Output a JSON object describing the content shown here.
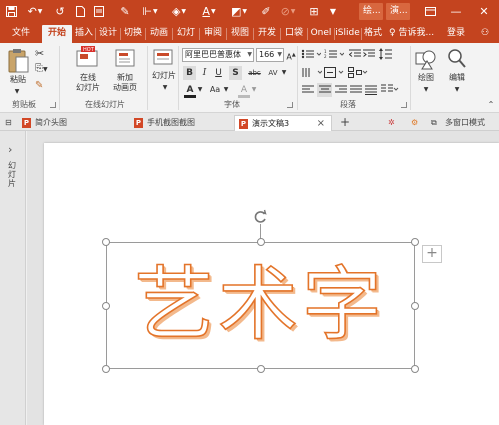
{
  "titlebar": {
    "window_tabs": [
      "绘...",
      "演..."
    ],
    "bg_color": "#c4441f"
  },
  "tabs": {
    "file": "文件",
    "home": "开始",
    "insert": "插入",
    "design": "设计",
    "transitions": "切换",
    "animations": "动画",
    "slideshow": "幻灯",
    "review": "审阅",
    "view": "视图",
    "developer": "开发",
    "pocket": "口袋",
    "onenote": "Onel",
    "islide": "iSlide",
    "format": "格式",
    "tell_me": "告诉我...",
    "login": "登录"
  },
  "ribbon": {
    "paste": "粘贴",
    "clipboard": "剪贴板",
    "online_slides": "在线\n幻灯片",
    "new_anim_page": "新加\n动画页",
    "online_slides_group": "在线幻灯片",
    "slides_btn": "幻灯片",
    "font_name": "阿里巴巴普惠体",
    "font_size": "166",
    "font_group": "字体",
    "paragraph_group": "段落",
    "draw": "绘图",
    "edit": "编辑",
    "bold": "B",
    "italic": "I",
    "underline": "U",
    "shadow": "S",
    "strike": "abc",
    "spacing": "AV",
    "font_color": "A",
    "case": "Aa",
    "highlight": "A"
  },
  "doc_tabs": {
    "tab1": "简介头图",
    "tab2": "手机截图截图",
    "tab3": "演示文稿3",
    "close": "×",
    "add": "+",
    "multi_window": "多窗口模式"
  },
  "left_panel": {
    "expand": "›",
    "label": "幻灯片"
  },
  "slide": {
    "art_text": "艺术字",
    "plus": "+"
  },
  "colors": {
    "accent": "#c4441f",
    "art_stroke": "#e3742a"
  }
}
